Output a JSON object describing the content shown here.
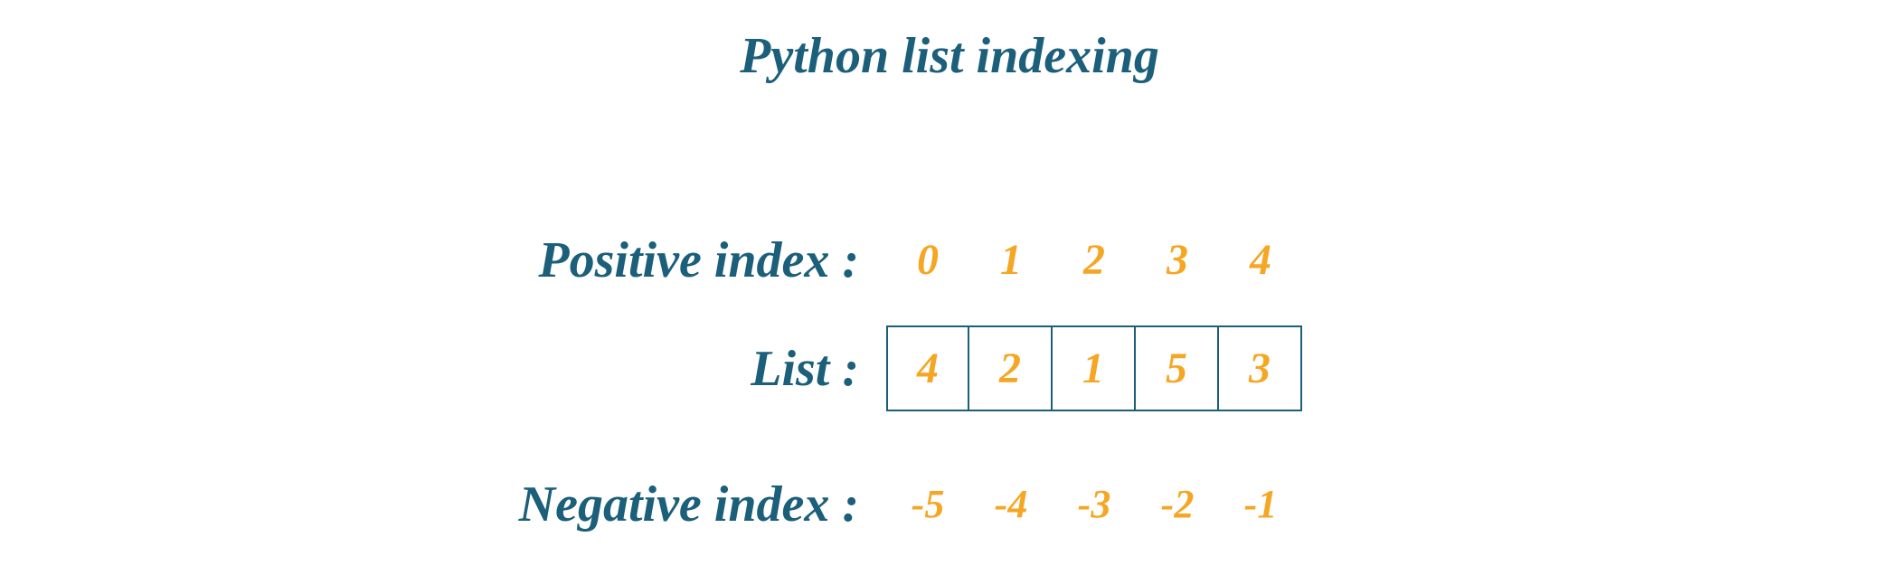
{
  "title": "Python list indexing",
  "rows": {
    "positive": {
      "label": "Positive index :",
      "values": [
        "0",
        "1",
        "2",
        "3",
        "4"
      ]
    },
    "list": {
      "label": "List :",
      "values": [
        "4",
        "2",
        "1",
        "5",
        "3"
      ]
    },
    "negative": {
      "label": "Negative index :",
      "values": [
        "-5",
        "-4",
        "-3",
        "-2",
        "-1"
      ]
    }
  }
}
